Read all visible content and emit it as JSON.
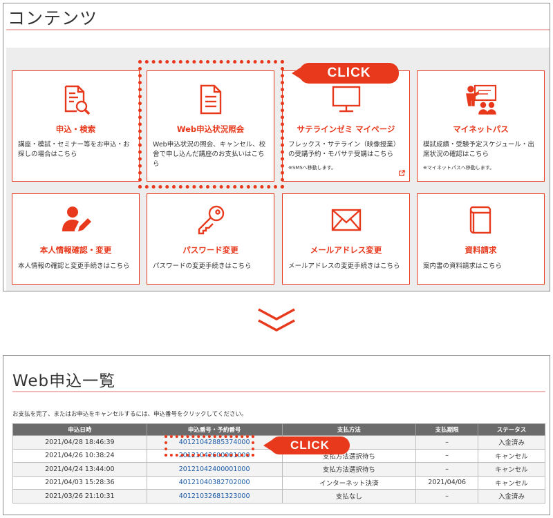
{
  "colors": {
    "accent": "#e8391d",
    "title_rule": "#f2b8b8",
    "table_header": "#6b6b6b",
    "link": "#1a5aa6"
  },
  "contents": {
    "title": "コンテンツ",
    "cards": [
      {
        "icon": "search-document-icon",
        "title": "申込・検索",
        "desc": "講座・模試・セミナー等をお申込・お探しの場合はこちら",
        "note": ""
      },
      {
        "icon": "document-icon",
        "title": "Web申込状況照会",
        "desc": "Web申込状況の照会、キャンセル、校舎で申し込んだ講座のお支払いはこちら",
        "note": ""
      },
      {
        "icon": "monitor-icon",
        "title": "サテラインゼミ マイページ",
        "desc": "フレックス・サテライン（映像授業）の受講予約・モバサテ受講はこちら",
        "note": "※SMSへ移動します。"
      },
      {
        "icon": "presentation-board-icon",
        "title": "マイネットパス",
        "desc": "模試成績・受験予定スケジュール・出席状況の確認はこちら",
        "note": "※マイネットパスへ移動します。"
      },
      {
        "icon": "user-edit-icon",
        "title": "本人情報確認・変更",
        "desc": "本人情報の確認と変更手続きはこちら",
        "note": ""
      },
      {
        "icon": "key-icon",
        "title": "パスワード変更",
        "desc": "パスワードの変更手続きはこちら",
        "note": ""
      },
      {
        "icon": "envelope-icon",
        "title": "メールアドレス変更",
        "desc": "メールアドレスの変更手続きはこちら",
        "note": ""
      },
      {
        "icon": "book-icon",
        "title": "資料請求",
        "desc": "案内書の資料請求はこちら",
        "note": ""
      }
    ]
  },
  "callouts": {
    "top": "CLICK",
    "bottom": "CLICK"
  },
  "web_list": {
    "title": "Web申込一覧",
    "notice": "お支払を完了、またはお申込をキャンセルするには、申込番号をクリックしてください。",
    "columns": [
      "申込日時",
      "申込番号・予約番号",
      "支払方法",
      "支払期限",
      "ステータス"
    ],
    "rows": [
      {
        "date": "2021/04/28 18:46:39",
        "number": "40121042885374000",
        "method": "",
        "deadline": "–",
        "status": "入金済み"
      },
      {
        "date": "2021/04/26 10:38:24",
        "number": "20121042600001000",
        "method": "支払方法選択待ち",
        "deadline": "–",
        "status": "キャンセル"
      },
      {
        "date": "2021/04/24 13:44:00",
        "number": "20121042400001000",
        "method": "支払方法選択待ち",
        "deadline": "–",
        "status": "キャンセル"
      },
      {
        "date": "2021/04/03 15:28:36",
        "number": "40121040382702000",
        "method": "インターネット決済",
        "deadline": "2021/04/06",
        "status": "キャンセル"
      },
      {
        "date": "2021/03/26 21:10:31",
        "number": "40121032681323000",
        "method": "支払なし",
        "deadline": "–",
        "status": "入金済み"
      }
    ]
  }
}
